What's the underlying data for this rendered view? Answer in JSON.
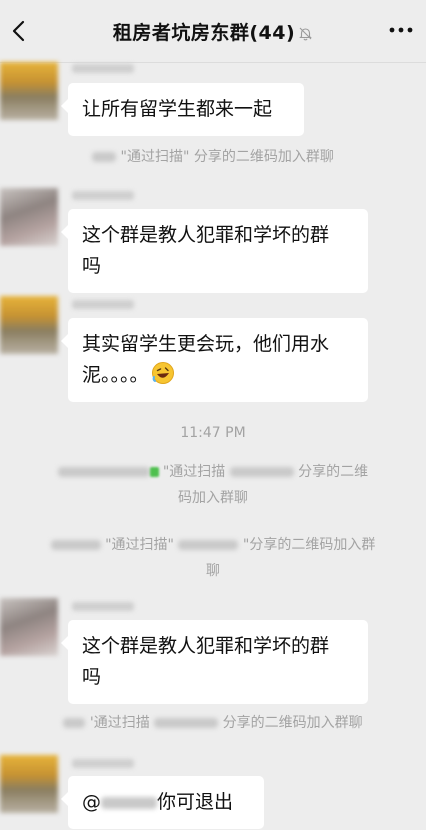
{
  "header": {
    "title": "租房者坑房东群(44)",
    "back_icon": "chevron-left-icon",
    "mute_icon": "bell-off-icon",
    "more_icon": "more-dots-icon"
  },
  "messages": [
    {
      "type": "text",
      "text": "让所有留学生都来一起"
    },
    {
      "type": "system",
      "text": "\"通过扫描\" 分享的二维码加入群聊"
    },
    {
      "type": "text",
      "line1": "这个群是教人犯罪和学坏的群",
      "line2": "吗"
    },
    {
      "type": "text",
      "line1": "其实留学生更会玩，他们用水",
      "line2": "泥。。。。",
      "emoji": "rolling-laughing-emoji"
    },
    {
      "type": "time",
      "text": "11:47 PM"
    },
    {
      "type": "system",
      "line1_a": "\"通过扫描",
      "line1_b": "分享的二维",
      "line2": "码加入群聊"
    },
    {
      "type": "system",
      "line1_a": "\"通过扫描\"",
      "line1_b": "\"分享的二维码加入群",
      "line2": "聊"
    },
    {
      "type": "text",
      "line1": "这个群是教人犯罪和学坏的群",
      "line2": "吗"
    },
    {
      "type": "system",
      "text_a": "'通过扫描",
      "text_b": "分享的二维码加入群聊"
    },
    {
      "type": "text",
      "prefix": "@",
      "suffix": "你可退出"
    }
  ],
  "colors": {
    "background": "#ededed",
    "bubble": "#ffffff",
    "system_text": "#a3a3a3"
  }
}
